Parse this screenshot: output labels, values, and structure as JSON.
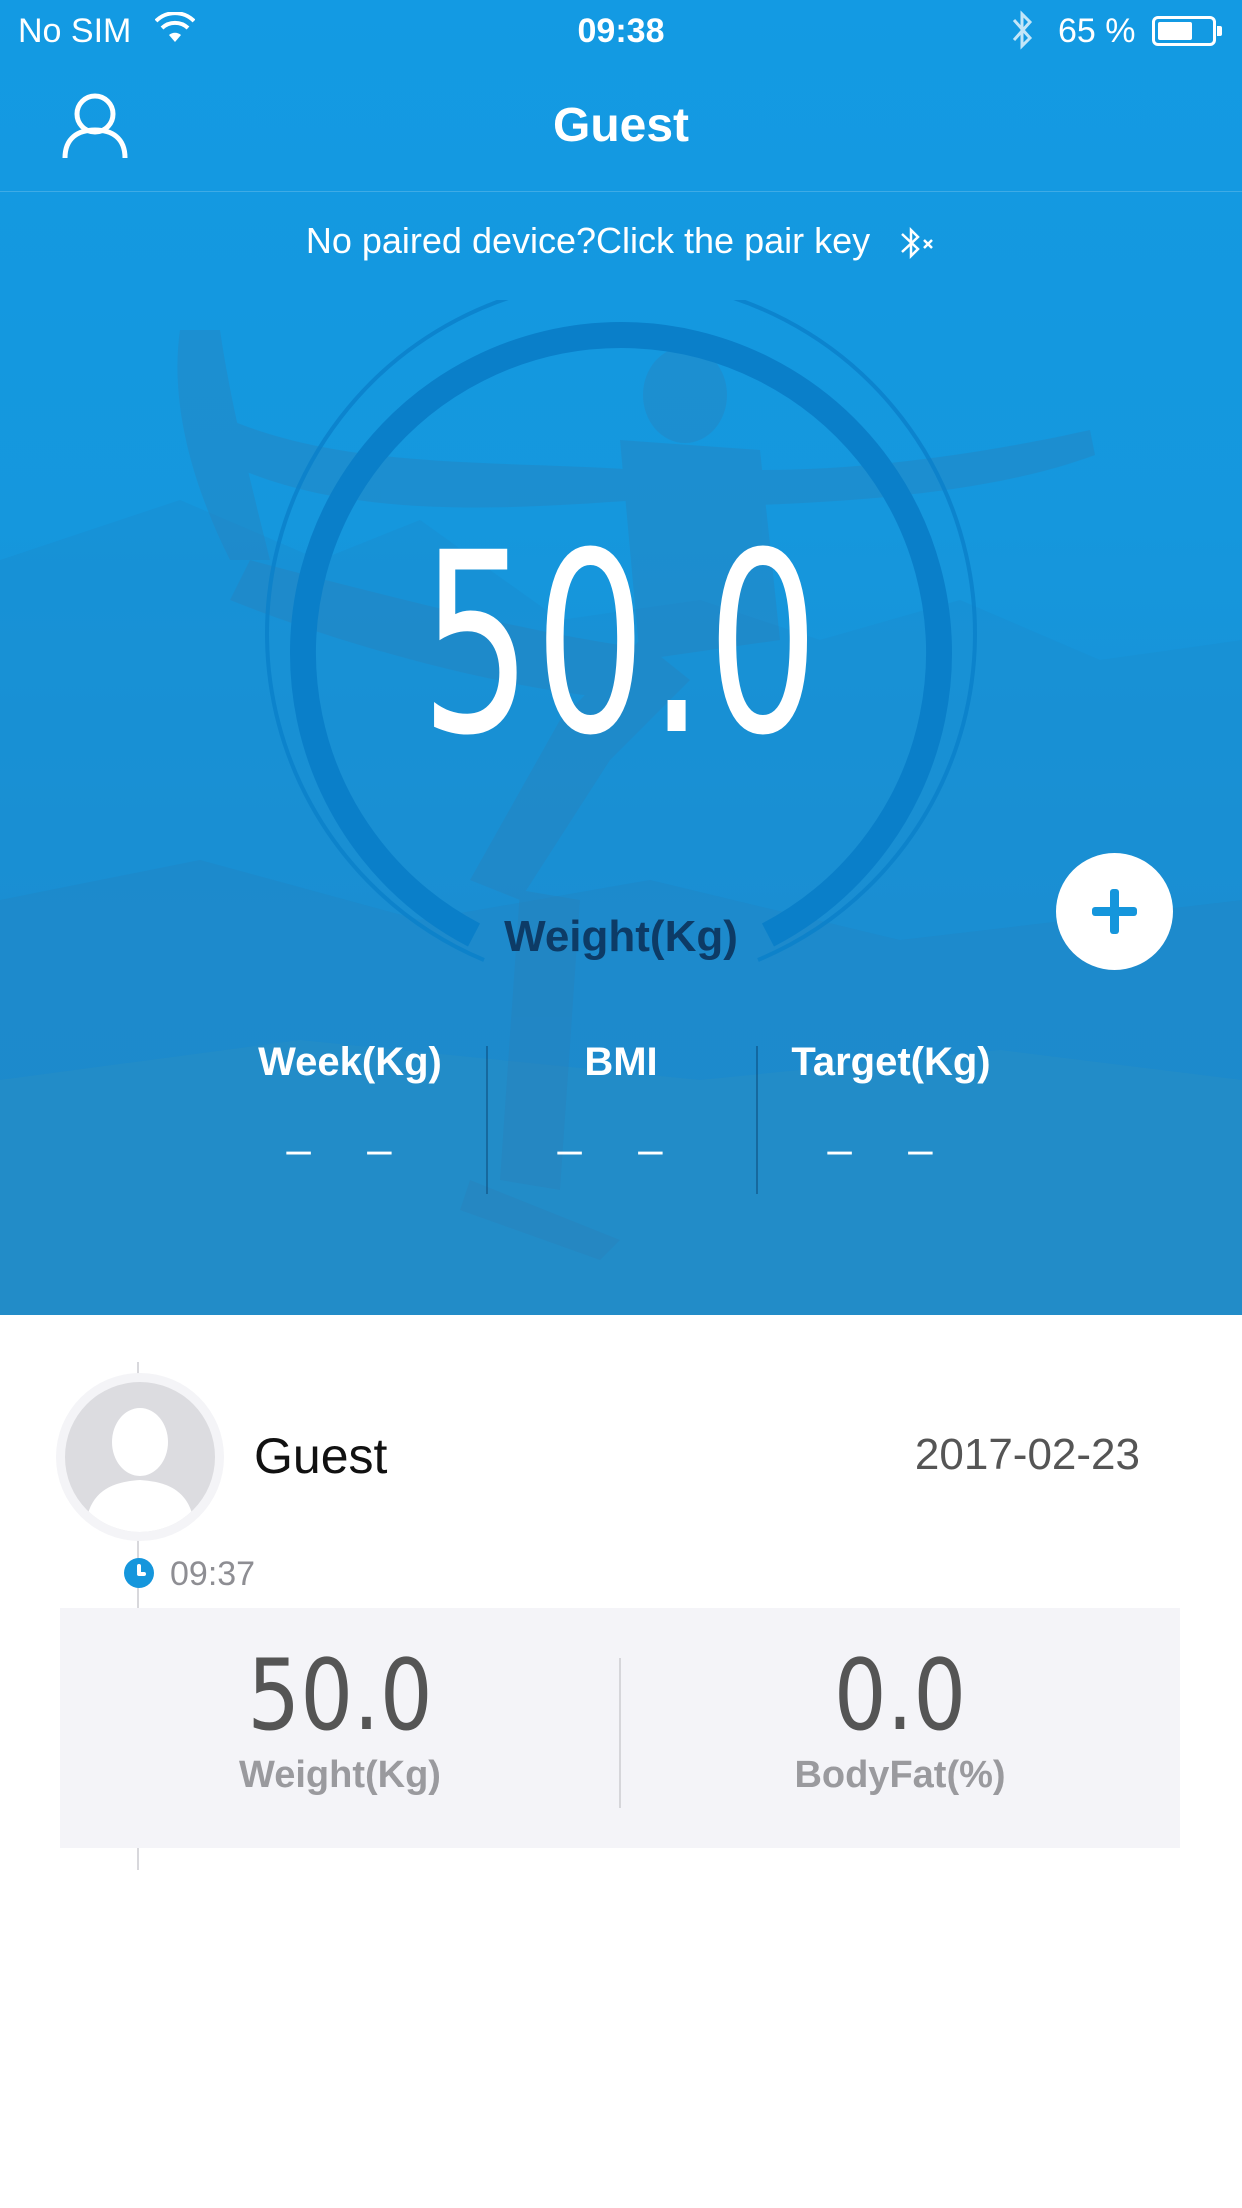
{
  "status_bar": {
    "carrier": "No SIM",
    "time": "09:38",
    "battery_percent": "65 %",
    "battery_level": 0.65
  },
  "nav": {
    "title": "Guest",
    "left_icon": "user-profile-icon"
  },
  "pair_hint": {
    "text": "No paired device?Click the pair key",
    "icon": "bluetooth-disconnected-icon"
  },
  "gauge": {
    "weight_value": "50.0",
    "weight_label": "Weight(Kg)"
  },
  "add_button": {
    "icon": "plus-icon"
  },
  "stats": [
    {
      "label": "Week(Kg)",
      "value": "– –"
    },
    {
      "label": "BMI",
      "value": "– –"
    },
    {
      "label": "Target(Kg)",
      "value": "– –"
    }
  ],
  "history_entry": {
    "user_name": "Guest",
    "date": "2017-02-23",
    "time": "09:37",
    "weight_value": "50.0",
    "weight_label": "Weight(Kg)",
    "bodyfat_value": "0.0",
    "bodyfat_label": "BodyFat(%)"
  },
  "colors": {
    "primary_blue": "#1596dc",
    "gauge_arc": "#0a7fc9",
    "card_bg": "#f4f4f8"
  }
}
